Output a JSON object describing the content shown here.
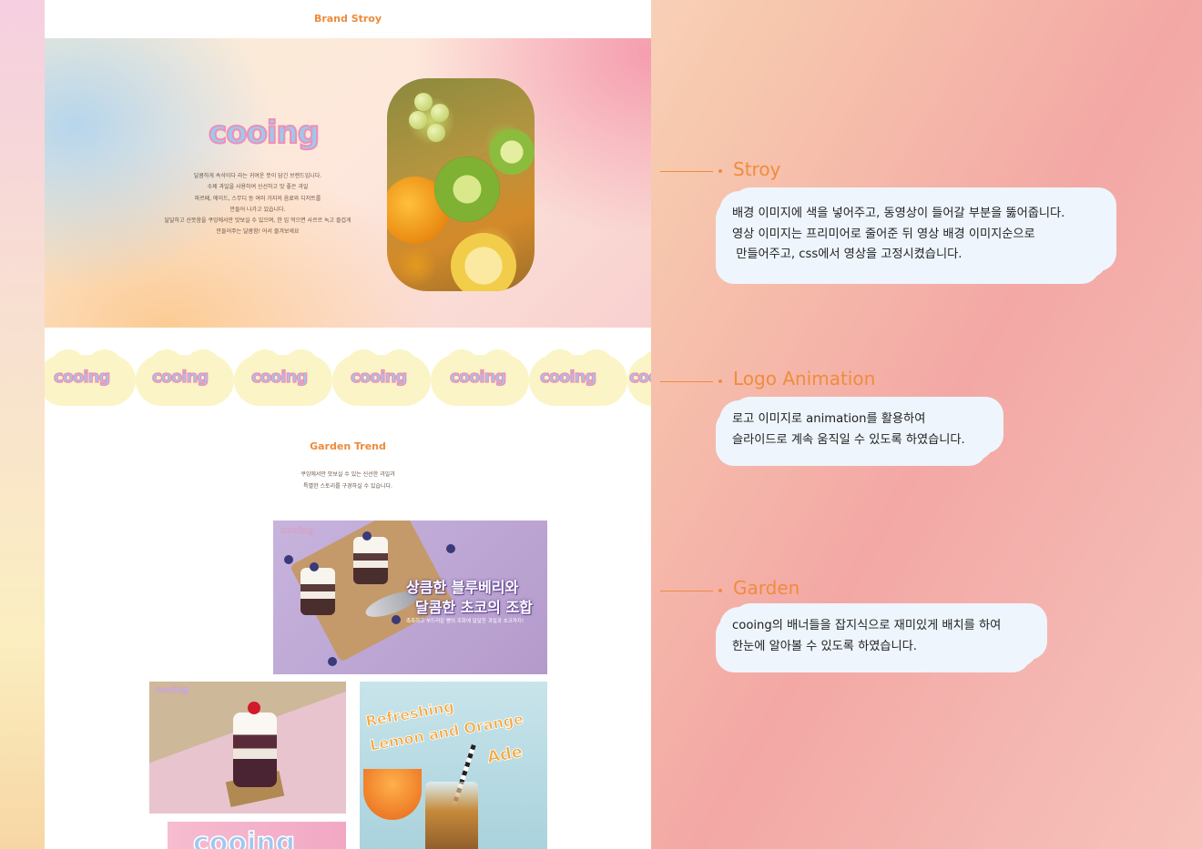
{
  "page": {
    "brand_title": "Brand Stroy",
    "brand_logo": "cooing",
    "hero_lines": [
      "달콤하게 속삭이다 라는 귀여운 뜻이 담긴 브랜드입니다.",
      "수제 과일을 사용하여 신선하고 맛 좋은 과일",
      "파르페, 에이드, 스무디 등 여러 가지의 음료와 디저트를",
      "만들어 나가고 있습니다.",
      "달달하고 산뜻함을 쿠잉에서만 맛보실 수 있으며, 한 입 먹으면 사르르 녹고 즐겁게",
      "만들어주는 달콤함! 어서 즐겨보세요"
    ],
    "strip_logos": [
      "cooing",
      "cooing",
      "cooing",
      "cooing",
      "cooing",
      "cooing",
      "cooing"
    ],
    "trend_title": "Garden Trend",
    "trend_lines": [
      "쿠잉에서만 맛보실 수 있는 신선한 과일과",
      "특별한 스토리를 구경하실 수 있습니다."
    ],
    "banner1": {
      "logo": "cooing",
      "headline1": "상큼한 블루베리와",
      "headline2": "달콤한 초코의 조합",
      "sub": "촉촉하고 부드러운 빵의 조화에 달달한 과일과 초코까지!"
    },
    "banner2": {
      "logo": "cooing"
    },
    "banner3": {
      "line1": "Refreshing",
      "line2": "Lemon and Orange",
      "line3": "Ade"
    },
    "banner4": {
      "logo": "cooing"
    }
  },
  "annotations": [
    {
      "title": "Stroy",
      "lines": [
        "배경 이미지에 색을 넣어주고, 동영상이 들어갈 부분을  뚫어줍니다.",
        "영상 이미지는 프리미어로 줄어준 뒤 영상 배경 이미지순으로",
        " 만들어주고, css에서 영상을 고정시켰습니다."
      ]
    },
    {
      "title": "Logo Animation",
      "lines": [
        "로고 이미지로 animation를 활용하여",
        "슬라이드로 계속 움직일 수 있도록 하였습니다."
      ]
    },
    {
      "title": "Garden",
      "lines": [
        "cooing의 배너들을 잡지식으로 재미있게 배치를 하여",
        "한눈에 알아볼 수 있도록 하였습니다."
      ]
    }
  ],
  "colors": {
    "accent": "#ef8c3e",
    "logo_fill": "#9ec8f0",
    "logo_stroke": "#f08fb3",
    "bubble": "#eef5fc"
  }
}
